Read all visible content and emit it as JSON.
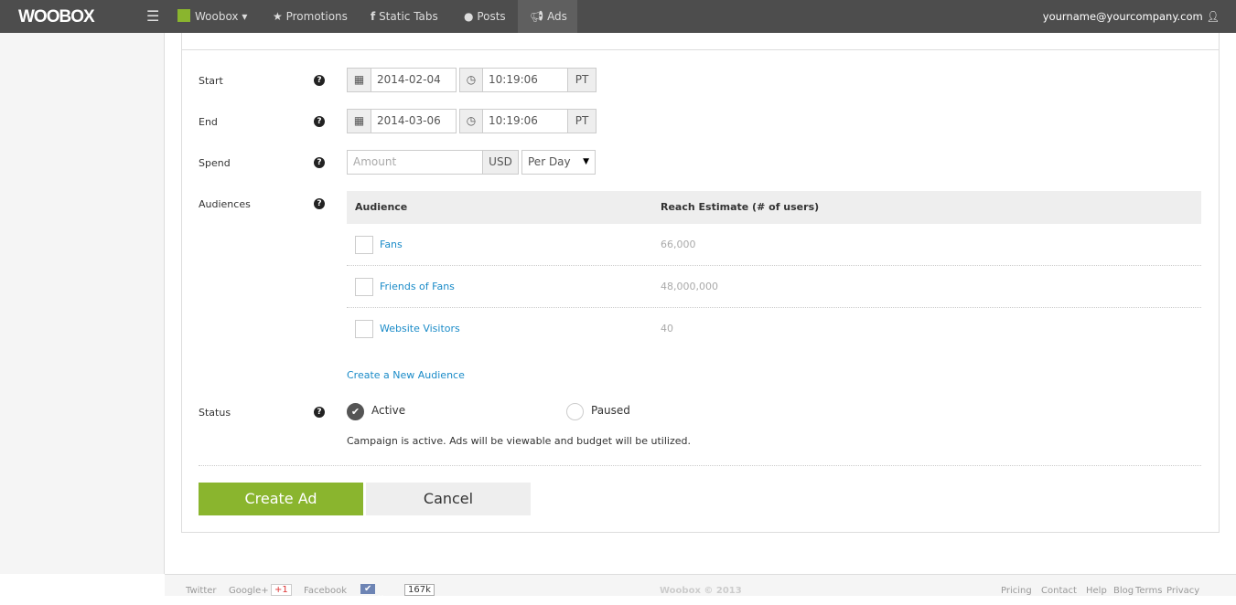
{
  "nav": {
    "logo": "WOOBOX",
    "brand": "Woobox",
    "items": [
      "Promotions",
      "Static Tabs",
      "Posts",
      "Ads"
    ],
    "active": "Ads",
    "user": "yourname@yourcompany.com"
  },
  "form": {
    "start": {
      "label": "Start",
      "date": "2014-02-04",
      "time": "10:19:06",
      "tz": "PT"
    },
    "end": {
      "label": "End",
      "date": "2014-03-06",
      "time": "10:19:06",
      "tz": "PT"
    },
    "spend": {
      "label": "Spend",
      "placeholder": "Amount",
      "currency": "USD",
      "period": "Per Day"
    },
    "audiences": {
      "label": "Audiences",
      "headers": [
        "Audience",
        "Reach Estimate (# of users)"
      ],
      "rows": [
        {
          "name": "Fans",
          "reach": "66,000",
          "checked": false
        },
        {
          "name": "Friends of Fans",
          "reach": "48,000,000",
          "checked": false
        },
        {
          "name": "Website Visitors",
          "reach": "40",
          "checked": false
        }
      ],
      "create_link": "Create a New Audience"
    },
    "status": {
      "label": "Status",
      "options": [
        "Active",
        "Paused"
      ],
      "selected": "Active",
      "description": "Campaign is active. Ads will be viewable and budget will be utilized."
    },
    "create_button": "Create Ad",
    "cancel_button": "Cancel"
  },
  "footer": {
    "links_left": [
      "Twitter",
      "Google+",
      "+1",
      "Facebook",
      "Like",
      "167k"
    ],
    "copyright": "Woobox © 2013",
    "links_right": [
      "Pricing",
      "Contact",
      "Help",
      "Blog",
      "Terms",
      "Privacy"
    ]
  },
  "colors": {
    "nav": "#4d4d4d",
    "accent": "#8ab52e",
    "link": "#1a8bc8"
  }
}
